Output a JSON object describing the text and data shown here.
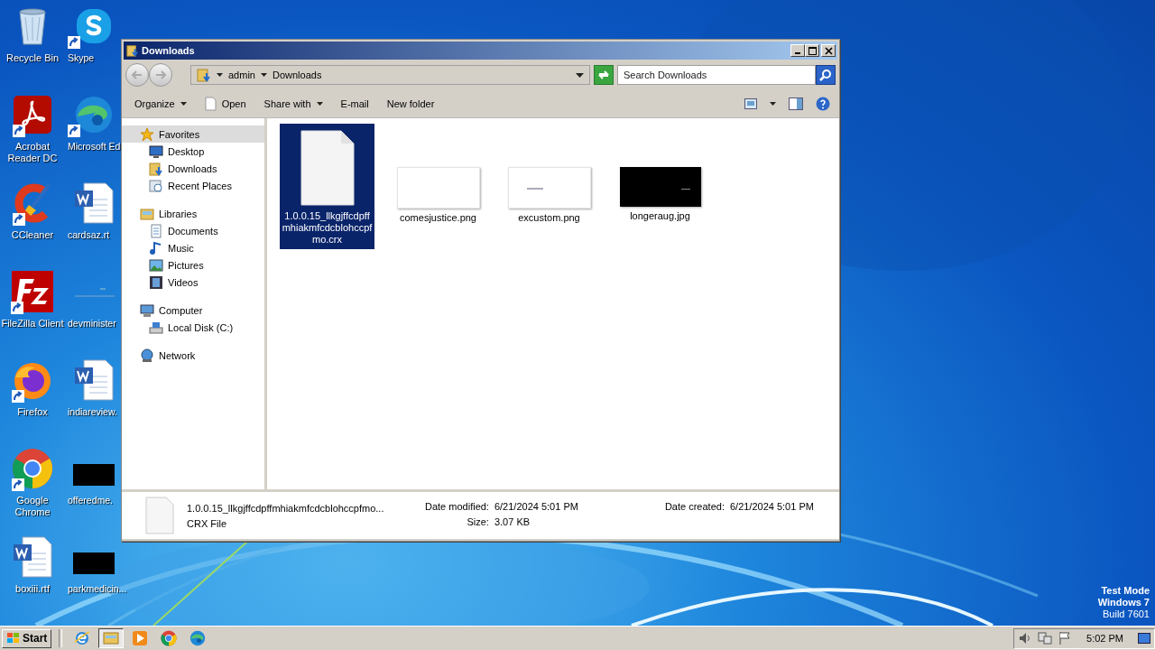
{
  "desktop": {
    "left_column": [
      {
        "label": "Recycle Bin",
        "kind": "recycle",
        "shortcut": false
      },
      {
        "label": "Acrobat Reader DC",
        "kind": "acrobat",
        "shortcut": true
      },
      {
        "label": "CCleaner",
        "kind": "ccleaner",
        "shortcut": true
      },
      {
        "label": "FileZilla Client",
        "kind": "filezilla",
        "shortcut": true
      },
      {
        "label": "Firefox",
        "kind": "firefox",
        "shortcut": true
      },
      {
        "label": "Google Chrome",
        "kind": "chrome",
        "shortcut": true
      },
      {
        "label": "boxiii.rtf",
        "kind": "word",
        "shortcut": false
      }
    ],
    "right_column": [
      {
        "label": "Skype",
        "kind": "skype",
        "shortcut": true
      },
      {
        "label": "Microsoft Ed",
        "kind": "edge",
        "shortcut": true
      },
      {
        "label": "cardsaz.rt",
        "kind": "word",
        "shortcut": false
      },
      {
        "label": "devminister",
        "kind": "blank",
        "shortcut": false
      },
      {
        "label": "indiareview.",
        "kind": "word",
        "shortcut": false
      },
      {
        "label": "offeredme.",
        "kind": "black",
        "shortcut": false
      },
      {
        "label": "parkmedicin...",
        "kind": "black",
        "shortcut": false
      }
    ]
  },
  "window": {
    "title": "Downloads",
    "breadcrumb": [
      "admin",
      "Downloads"
    ],
    "search": {
      "placeholder": "Search Downloads"
    },
    "organize": "Organize",
    "toolbar": [
      {
        "label": "Open",
        "kind": "open"
      },
      {
        "label": "Share with",
        "kind": "menu"
      },
      {
        "label": "E-mail",
        "kind": "plain"
      },
      {
        "label": "New folder",
        "kind": "plain"
      }
    ],
    "navigation": [
      {
        "label": "Favorites",
        "kind": "star",
        "selected": true,
        "children": [
          {
            "label": "Desktop",
            "kind": "desktop",
            "selected": false
          },
          {
            "label": "Downloads",
            "kind": "downloads",
            "selected": false
          },
          {
            "label": "Recent Places",
            "kind": "recent",
            "selected": false
          }
        ]
      },
      {
        "label": "Libraries",
        "kind": "libraries",
        "selected": false,
        "children": [
          {
            "label": "Documents",
            "kind": "documents",
            "selected": false
          },
          {
            "label": "Music",
            "kind": "music",
            "selected": false
          },
          {
            "label": "Pictures",
            "kind": "pictures",
            "selected": false
          },
          {
            "label": "Videos",
            "kind": "videos",
            "selected": false
          }
        ]
      },
      {
        "label": "Computer",
        "kind": "computer",
        "selected": false,
        "children": [
          {
            "label": "Local Disk (C:)",
            "kind": "disk",
            "selected": false
          }
        ]
      },
      {
        "label": "Network",
        "kind": "network",
        "selected": false
      }
    ],
    "files": [
      {
        "name": "1.0.0.15_llkgjffcdpffmhiakmfcdcblohccpfmo.crx",
        "kind": "document",
        "selected": true
      },
      {
        "name": "comesjustice.png",
        "kind": "white",
        "selected": false
      },
      {
        "name": "excustom.png",
        "kind": "white-text",
        "selected": false
      },
      {
        "name": "longeraug.jpg",
        "kind": "black",
        "selected": false
      }
    ],
    "details": {
      "name": "1.0.0.15_llkgjffcdpffmhiakmfcdcblohccpfmo...",
      "type": "CRX File",
      "fields": [
        {
          "label": "Date modified:",
          "value": "6/21/2024 5:01 PM"
        },
        {
          "label": "Size:",
          "value": "3.07 KB"
        },
        {
          "label": "Date created:",
          "value": "6/21/2024 5:01 PM"
        }
      ]
    }
  },
  "system_info": [
    "Test Mode",
    "Windows 7",
    "Build 7601"
  ],
  "taskbar": {
    "start": "Start",
    "apps": [
      {
        "kind": "ie",
        "selected": false
      },
      {
        "kind": "explorer",
        "selected": true
      },
      {
        "kind": "media",
        "selected": false
      },
      {
        "kind": "chrome",
        "selected": false
      },
      {
        "kind": "edge",
        "selected": false
      }
    ],
    "clock": "5:02 PM"
  }
}
